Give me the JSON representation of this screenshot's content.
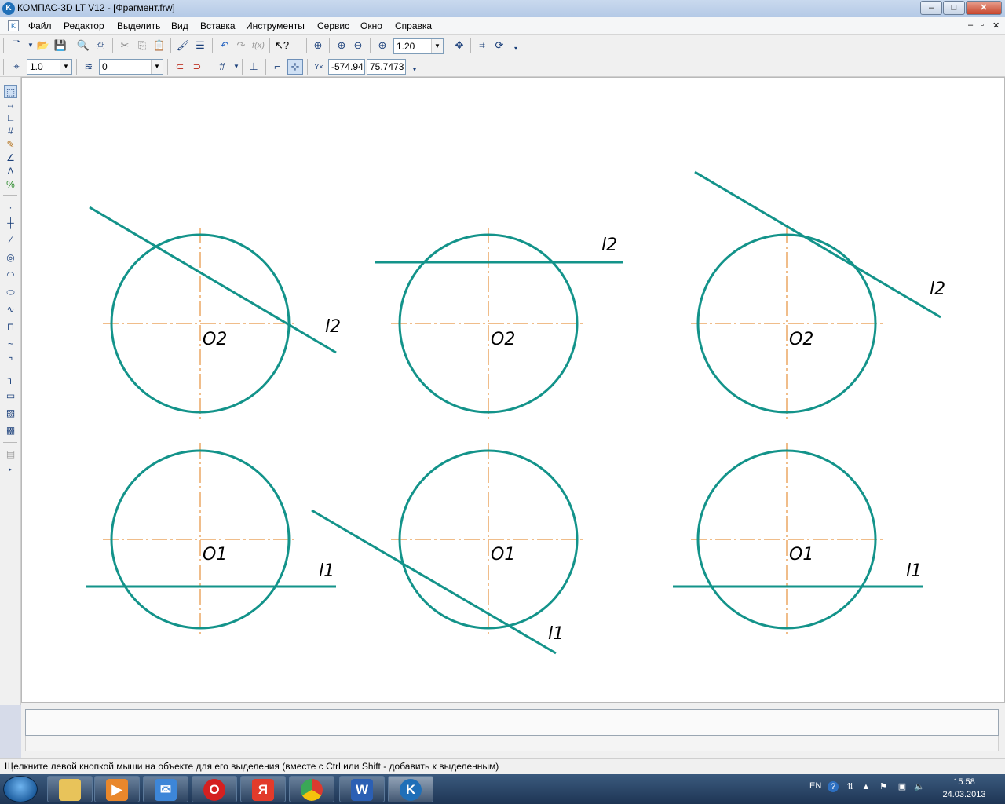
{
  "window": {
    "title": "КОМПАС-3D LT V12 - [Фрагмент.frw]",
    "app_icon_letter": "K",
    "controls": {
      "minimize": "–",
      "maximize": "□",
      "close": "✕"
    },
    "doc_controls": {
      "minimize": "–",
      "restore": "▫",
      "close": "✕"
    }
  },
  "menu": {
    "items": [
      "Файл",
      "Редактор",
      "Выделить",
      "Вид",
      "Вставка",
      "Инструменты",
      "Сервис",
      "Окно",
      "Справка"
    ]
  },
  "toolbar1": {
    "zoom_value": "1.20",
    "icons": [
      "new-icon",
      "open-icon",
      "save-icon",
      "preview-icon",
      "print-icon",
      "cut-icon",
      "copy-icon",
      "paste-icon",
      "format-brush-icon",
      "properties-icon",
      "undo-icon",
      "redo-icon",
      "variables-icon",
      "help-pointer-icon",
      "zoom-window-icon",
      "zoom-in-icon",
      "zoom-out-icon",
      "zoom-scale-icon",
      "pan-icon",
      "redraw-icon",
      "refresh-icon"
    ]
  },
  "toolbar2": {
    "step_value": "1.0",
    "layer_value": "0",
    "coord_x": "-574.94",
    "coord_y": "75.7473"
  },
  "left_panel": {
    "icons": [
      "select-icon",
      "dimensions-icon",
      "geometry-icon",
      "grid-icon",
      "edit-icon",
      "parametric-icon",
      "symbols-icon",
      "measure-icon",
      "point-icon",
      "aux-line-icon",
      "segment-icon",
      "circle-icon",
      "arc-icon",
      "ellipse-icon",
      "spline-icon",
      "polyline-icon",
      "chamfer-icon",
      "fillet-icon",
      "rectangle-icon",
      "hatch-icon",
      "fill-icon",
      "library-icon"
    ]
  },
  "drawing": {
    "labels": {
      "o2": "O2",
      "o1": "O1",
      "l2": "l2",
      "l1": "l1"
    },
    "colors": {
      "circle": "#13938a",
      "axis": "#e07b16",
      "text": "#000000"
    }
  },
  "status": {
    "hint": "Щелкните левой кнопкой мыши на объекте для его выделения (вместе с Ctrl или Shift - добавить к выделенным)"
  },
  "taskbar": {
    "apps": [
      "explorer-icon",
      "media-player-icon",
      "mail-icon",
      "opera-icon",
      "yandex-icon",
      "chrome-icon",
      "word-icon",
      "kompas-icon"
    ],
    "app_letters": {
      "opera": "O",
      "yandex": "Я",
      "word": "W",
      "kompas": "K"
    },
    "language": "EN",
    "time": "15:58",
    "date": "24.03.2013"
  }
}
